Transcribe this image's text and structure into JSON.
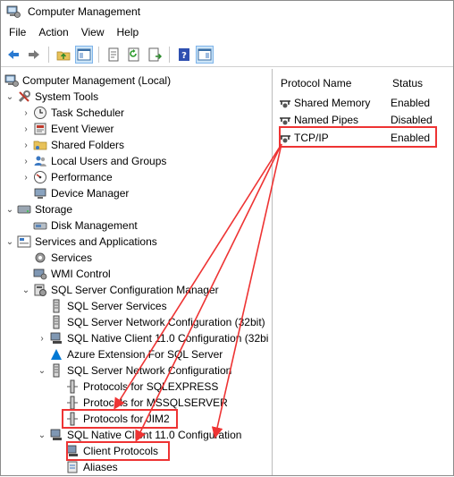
{
  "window": {
    "title": "Computer Management"
  },
  "menu": [
    "File",
    "Action",
    "View",
    "Help"
  ],
  "toolbar": {
    "icons": [
      "back-icon",
      "forward-icon",
      "up-folder-icon",
      "show-hide-tree-icon",
      "properties-icon",
      "refresh-icon",
      "export-icon",
      "help-icon",
      "show-action-pane-icon"
    ]
  },
  "tree": {
    "root": "Computer Management (Local)",
    "system_tools": "System Tools",
    "task_scheduler": "Task Scheduler",
    "event_viewer": "Event Viewer",
    "shared_folders": "Shared Folders",
    "local_users": "Local Users and Groups",
    "performance": "Performance",
    "device_manager": "Device Manager",
    "storage": "Storage",
    "disk_management": "Disk Management",
    "services_apps": "Services and Applications",
    "services": "Services",
    "wmi": "WMI Control",
    "sql_config": "SQL Server Configuration Manager",
    "sql_services": "SQL Server Services",
    "sql_net32": "SQL Server Network Configuration (32bit)",
    "native32": "SQL Native Client 11.0 Configuration (32bi",
    "azure": "Azure Extension For SQL Server",
    "sql_net": "SQL Server Network Configuration",
    "proto_express": "Protocols for SQLEXPRESS",
    "proto_mssql": "Protocols for MSSQLSERVER",
    "proto_jim": "Protocols for JIM2",
    "native": "SQL Native Client 11.0 Configuration",
    "client_protocols": "Client Protocols",
    "aliases": "Aliases"
  },
  "list": {
    "headers": {
      "name": "Protocol Name",
      "status": "Status"
    },
    "rows": [
      {
        "name": "Shared Memory",
        "status": "Enabled"
      },
      {
        "name": "Named Pipes",
        "status": "Disabled"
      },
      {
        "name": "TCP/IP",
        "status": "Enabled"
      }
    ]
  },
  "annotation_color": "#e33333"
}
